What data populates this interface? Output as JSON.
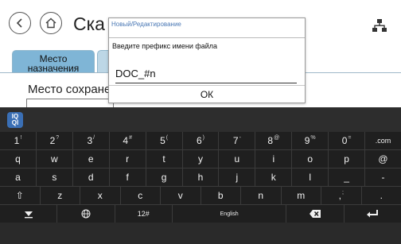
{
  "screen": {
    "title": "Ска",
    "back_icon": "chevron-left-icon",
    "home_icon": "home-icon",
    "network_icon": "network-icon",
    "tabs": [
      {
        "label": "Место назначения",
        "active": true
      },
      {
        "label": "",
        "active": false
      }
    ],
    "panel_label": "Место сохране"
  },
  "dialog": {
    "title": "Новый/Редактирование",
    "prompt": "Введите префикс имени файла",
    "value": "DOC_#n",
    "ok_label": "ОК"
  },
  "keyboard": {
    "mode_label": "IQ QI",
    "rows": [
      [
        {
          "main": "1",
          "alt": "!"
        },
        {
          "main": "2",
          "alt": "?"
        },
        {
          "main": "3",
          "alt": "/"
        },
        {
          "main": "4",
          "alt": "#"
        },
        {
          "main": "5",
          "alt": "("
        },
        {
          "main": "6",
          "alt": ")"
        },
        {
          "main": "7",
          "alt": "-"
        },
        {
          "main": "8",
          "alt": "@"
        },
        {
          "main": "9",
          "alt": "%"
        },
        {
          "main": "0",
          "alt": "="
        },
        {
          "main": ".com",
          "alt": ""
        }
      ],
      [
        {
          "main": "q",
          "alt": ""
        },
        {
          "main": "w",
          "alt": ""
        },
        {
          "main": "e",
          "alt": ""
        },
        {
          "main": "r",
          "alt": ""
        },
        {
          "main": "t",
          "alt": ""
        },
        {
          "main": "y",
          "alt": ""
        },
        {
          "main": "u",
          "alt": ""
        },
        {
          "main": "i",
          "alt": ""
        },
        {
          "main": "o",
          "alt": ""
        },
        {
          "main": "p",
          "alt": ""
        },
        {
          "main": "@",
          "alt": ""
        }
      ],
      [
        {
          "main": "a",
          "alt": ""
        },
        {
          "main": "s",
          "alt": ""
        },
        {
          "main": "d",
          "alt": ""
        },
        {
          "main": "f",
          "alt": ""
        },
        {
          "main": "g",
          "alt": ""
        },
        {
          "main": "h",
          "alt": ""
        },
        {
          "main": "j",
          "alt": ""
        },
        {
          "main": "k",
          "alt": ""
        },
        {
          "main": "l",
          "alt": ""
        },
        {
          "main": "_",
          "alt": ""
        },
        {
          "main": "-",
          "alt": ""
        }
      ],
      [
        {
          "main": "⇧",
          "alt": ""
        },
        {
          "main": "z",
          "alt": ""
        },
        {
          "main": "x",
          "alt": ""
        },
        {
          "main": "c",
          "alt": ""
        },
        {
          "main": "v",
          "alt": ""
        },
        {
          "main": "b",
          "alt": ""
        },
        {
          "main": "n",
          "alt": ""
        },
        {
          "main": "m",
          "alt": ""
        },
        {
          "main": ",",
          "alt": ";"
        },
        {
          "main": ".",
          "alt": ""
        }
      ]
    ],
    "bottom": {
      "hide_icon": "hide-keyboard-icon",
      "globe_icon": "globe-icon",
      "symbols_label": "12#",
      "space_label": "English",
      "backspace_icon": "backspace-icon",
      "enter_icon": "enter-icon"
    }
  },
  "colors": {
    "tab_active": "#7fb5d6",
    "dialog_title": "#4a78b5",
    "keyboard_bg": "#1f1f1f",
    "iq_button": "#3a6fb5"
  }
}
